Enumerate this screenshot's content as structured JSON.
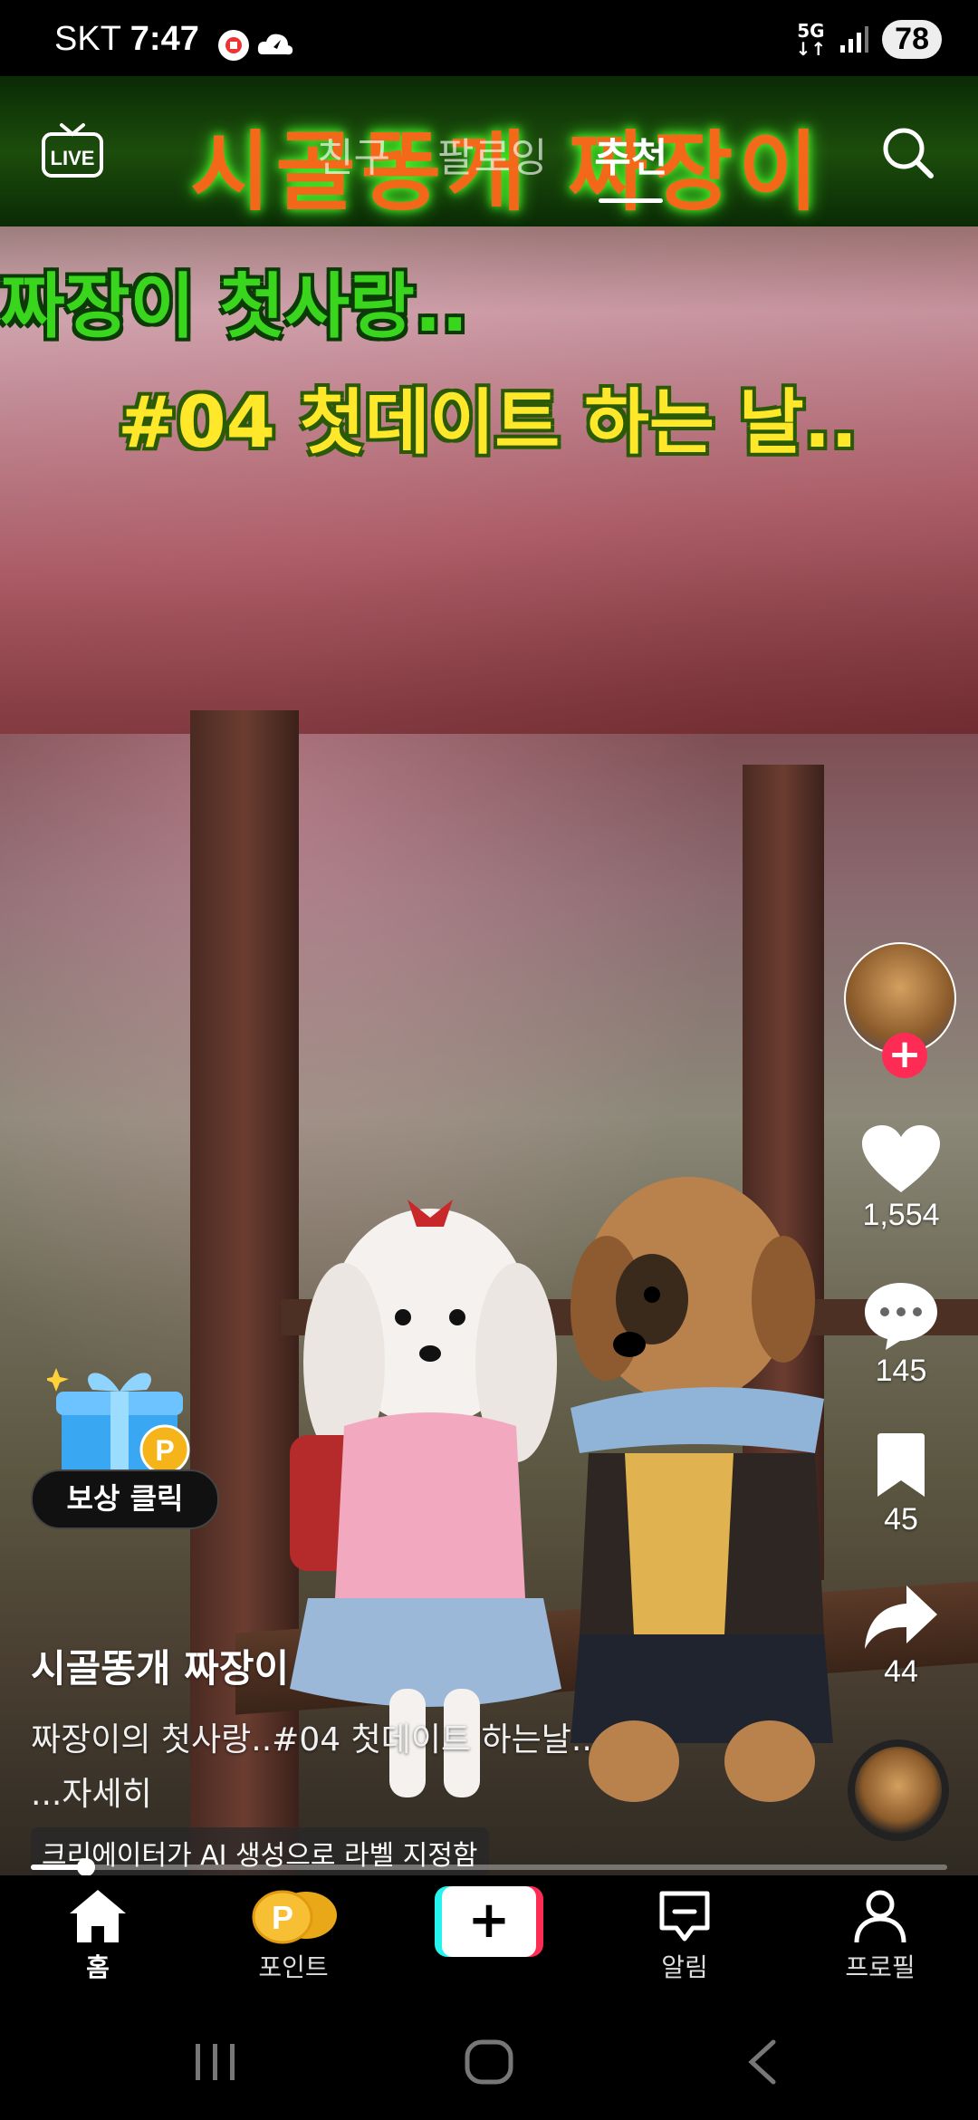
{
  "status_bar": {
    "carrier": "SKT",
    "time": "7:47",
    "network": "5G",
    "battery": "78"
  },
  "video_overlay": {
    "channel_banner": "시골똥개 짜장이",
    "title_line1": "짜장이 첫사랑..",
    "title_line2": "#04 첫데이트 하는 날.."
  },
  "top_nav": {
    "live_icon": "live-tv-icon",
    "tabs": [
      {
        "label": "친구",
        "active": false
      },
      {
        "label": "팔로잉",
        "active": false
      },
      {
        "label": "추천",
        "active": true
      }
    ],
    "search_icon": "search-icon"
  },
  "actions": {
    "likes": "1,554",
    "comments": "145",
    "saves": "45",
    "shares": "44"
  },
  "reward": {
    "label": "보상 클릭"
  },
  "caption": {
    "author": "시골똥개 짜장이",
    "description": "짜장이의 첫사랑..#04 첫데이트 하는날..",
    "more": "...자세히",
    "ai_label": "크리에이터가 AI 생성으로 라벨 지정함"
  },
  "playback": {
    "progress": 0.06
  },
  "bottom_nav": {
    "home": "홈",
    "points": "포인트",
    "inbox": "알림",
    "profile": "프로필"
  },
  "colors": {
    "accent_red": "#fe2c55",
    "accent_cyan": "#25f4ee"
  }
}
